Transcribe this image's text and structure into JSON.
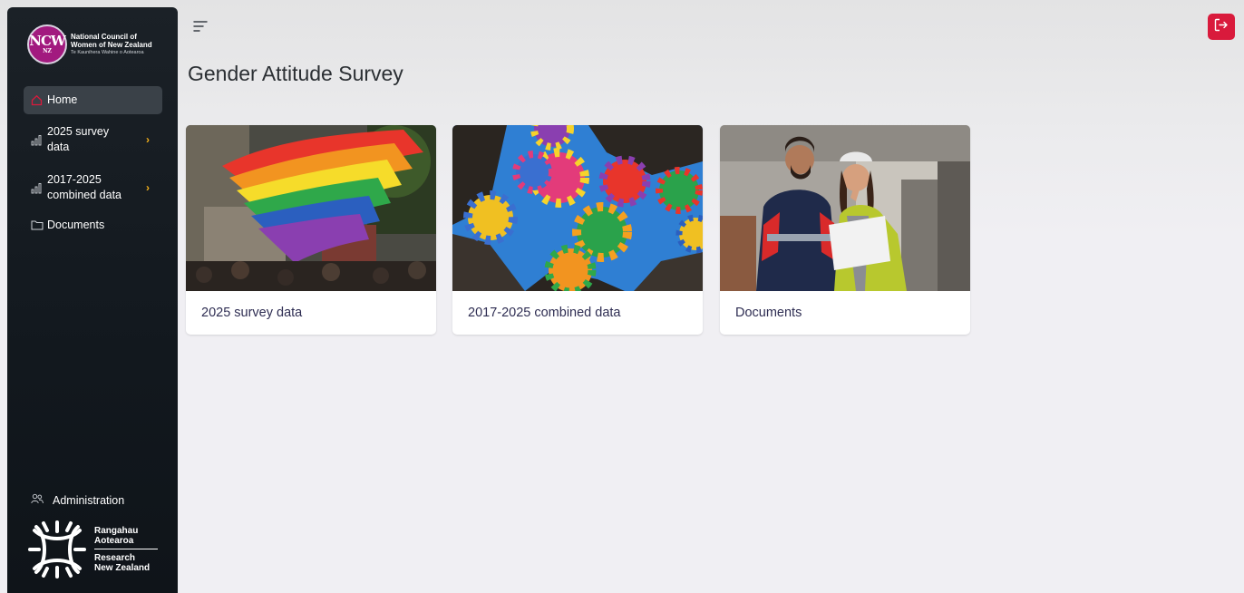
{
  "brand": {
    "ncw_badge": "NCW",
    "ncw_badge_sub": "NZ",
    "ncw_line1": "National Council of",
    "ncw_line2": "Women of New Zealand",
    "ncw_line3": "Te Kaunihera Wahine o Aotearoa",
    "rnz_line1": "Rangahau",
    "rnz_line2": "Aotearoa",
    "rnz_line3": "Research",
    "rnz_line4": "New Zealand"
  },
  "sidebar": {
    "items": [
      {
        "label": "Home",
        "icon": "home-icon",
        "active": true
      },
      {
        "label_1": "2025 survey",
        "label_2": "data",
        "icon": "bar-chart-icon",
        "chevron": "›"
      },
      {
        "label_1": "2017-2025",
        "label_2": "combined data",
        "icon": "bar-chart-icon",
        "chevron": "›"
      },
      {
        "label": "Documents",
        "icon": "folder-icon"
      }
    ],
    "admin_label": "Administration"
  },
  "header": {
    "title": "Gender Attitude Survey"
  },
  "cards": [
    {
      "caption": "2025 survey data",
      "image": "rainbow-flag-crowd"
    },
    {
      "caption": "2017-2025 combined data",
      "image": "rainbow-umbrellas"
    },
    {
      "caption": "Documents",
      "image": "construction-workers"
    }
  ],
  "colors": {
    "accent_red": "#d91a3c",
    "chevron": "#f6b21a",
    "brand_purple": "#a21a7f",
    "sidebar_bg": "#151b21",
    "card_caption": "#2e2d52"
  }
}
